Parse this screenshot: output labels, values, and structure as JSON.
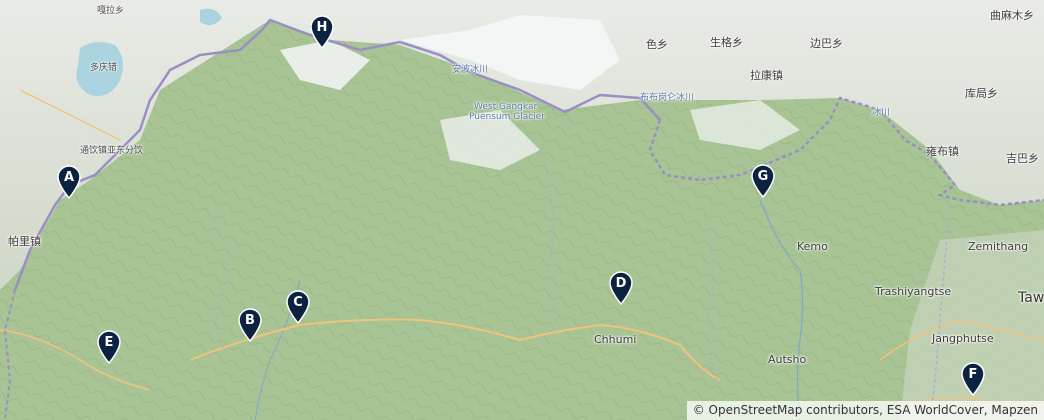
{
  "attribution": "© OpenStreetMap contributors, ESA WorldCover, Mapzen",
  "labels": [
    {
      "id": "galaxiang",
      "text": "嘎拉乡"
    },
    {
      "id": "duoqingzhen",
      "text": "多庆错"
    },
    {
      "id": "tongmen",
      "text": "通饮镇亚东分饮"
    },
    {
      "id": "palizhen",
      "text": "帕里镇"
    },
    {
      "id": "sexiang",
      "text": "色乡"
    },
    {
      "id": "shenggexiang",
      "text": "生格乡"
    },
    {
      "id": "bianbaxiang",
      "text": "边巴乡"
    },
    {
      "id": "qumumuxiang",
      "text": "曲麻木乡"
    },
    {
      "id": "lakangzhen",
      "text": "拉康镇"
    },
    {
      "id": "kujuxiang",
      "text": "库局乡"
    },
    {
      "id": "yongbuzhen",
      "text": "雍布镇"
    },
    {
      "id": "jibaxiang",
      "text": "吉巴乡"
    },
    {
      "id": "angbubingchuan",
      "text": "安波冰川"
    },
    {
      "id": "bubugangbingchuan",
      "text": "布布岗仑冰川"
    },
    {
      "id": "westgangkar",
      "text": "West Gangkar"
    },
    {
      "id": "puensum",
      "text": "Puensum Glacier"
    },
    {
      "id": "bingchuan2",
      "text": "冰川"
    },
    {
      "id": "kemo",
      "text": "Kemo"
    },
    {
      "id": "zemithang",
      "text": "Zemithang"
    },
    {
      "id": "trashiyangtse",
      "text": "Trashiyangtse"
    },
    {
      "id": "jangphutse",
      "text": "Jangphutse"
    },
    {
      "id": "chhumi",
      "text": "Chhumi"
    },
    {
      "id": "autsho",
      "text": "Autsho"
    },
    {
      "id": "taw",
      "text": "Taw"
    }
  ],
  "markers": [
    {
      "id": "A",
      "label": "A"
    },
    {
      "id": "B",
      "label": "B"
    },
    {
      "id": "C",
      "label": "C"
    },
    {
      "id": "D",
      "label": "D"
    },
    {
      "id": "E",
      "label": "E"
    },
    {
      "id": "F",
      "label": "F"
    },
    {
      "id": "G",
      "label": "G"
    },
    {
      "id": "H",
      "label": "H"
    }
  ],
  "colors": {
    "marker": "#0b2240",
    "border": "#9b8ec4",
    "water": "#aad3df",
    "road": "#f2c27a"
  }
}
